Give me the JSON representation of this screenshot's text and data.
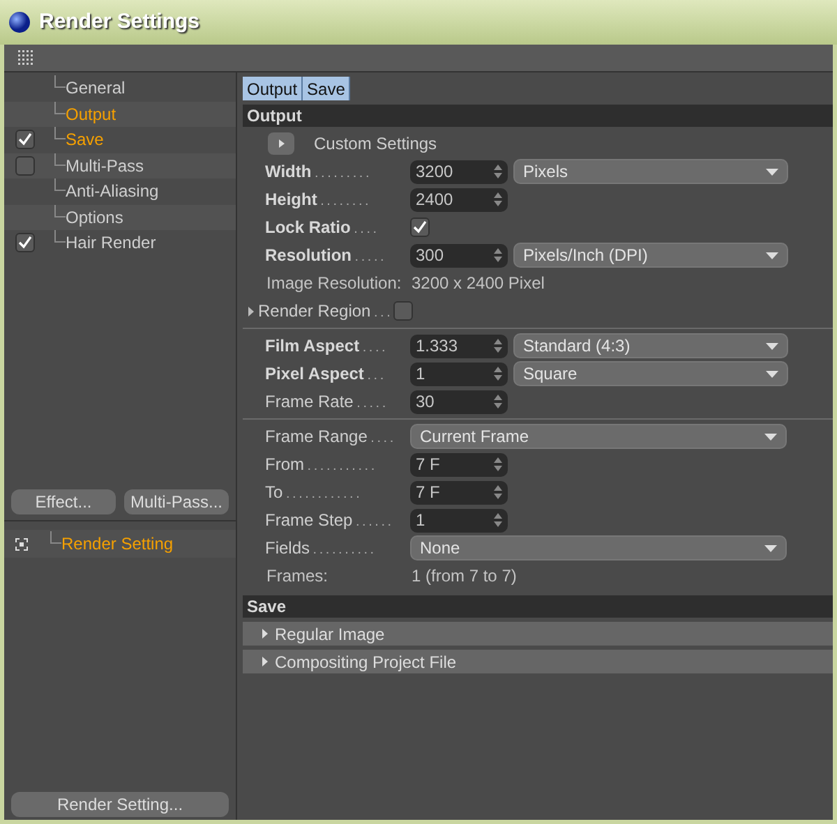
{
  "window": {
    "title": "Render Settings"
  },
  "tree": [
    {
      "label": "General",
      "kind": "plain",
      "highlighted": false
    },
    {
      "label": "Output",
      "kind": "plain",
      "highlighted": true
    },
    {
      "label": "Save",
      "kind": "check",
      "checked": true,
      "highlighted": true
    },
    {
      "label": "Multi-Pass",
      "kind": "check",
      "checked": false,
      "highlighted": false
    },
    {
      "label": "Anti-Aliasing",
      "kind": "plain",
      "highlighted": false
    },
    {
      "label": "Options",
      "kind": "plain",
      "highlighted": false
    },
    {
      "label": "Hair Render",
      "kind": "check",
      "checked": true,
      "highlighted": false
    }
  ],
  "left_buttons": [
    "Effect...",
    "Multi-Pass..."
  ],
  "presets": [
    {
      "label": "Render Setting",
      "highlighted": true
    }
  ],
  "bottom_button": "Render Setting...",
  "tabs": [
    {
      "label": "Output",
      "selected": true
    },
    {
      "label": "Save",
      "selected": true
    }
  ],
  "output": {
    "title": "Output",
    "groups": [
      [
        {
          "kind": "expander",
          "label": "Custom Settings"
        },
        {
          "kind": "number_select",
          "label": "Width",
          "leader": ". . . . . . . . .",
          "bold": true,
          "value": "3200",
          "option": "Pixels"
        },
        {
          "kind": "number",
          "label": "Height",
          "leader": ". . . . . . . .",
          "bold": true,
          "value": "2400"
        },
        {
          "kind": "check",
          "label": "Lock Ratio",
          "leader": ". . . .",
          "bold": true,
          "checked": true
        },
        {
          "kind": "number_select",
          "label": "Resolution",
          "leader": ". . . . .",
          "bold": true,
          "value": "300",
          "option": "Pixels/Inch (DPI)"
        },
        {
          "kind": "info",
          "label": "Image Resolution:",
          "value": "3200 x 2400 Pixel"
        },
        {
          "kind": "collapsed_check",
          "label": "Render Region",
          "leader": ". . .",
          "bold": false,
          "checked": false
        }
      ],
      [
        {
          "kind": "number_select",
          "label": "Film Aspect",
          "leader": ". . . .",
          "bold": true,
          "value": "1.333",
          "option": "Standard (4:3)"
        },
        {
          "kind": "number_select",
          "label": "Pixel Aspect",
          "leader": ". . .",
          "bold": true,
          "value": "1",
          "option": "Square"
        },
        {
          "kind": "number",
          "label": "Frame Rate",
          "leader": ". . . . .",
          "bold": false,
          "value": "30"
        }
      ],
      [
        {
          "kind": "select",
          "label": "Frame Range",
          "leader": ". . . .",
          "bold": false,
          "option": "Current Frame"
        },
        {
          "kind": "number",
          "label": "From",
          "leader": ". . . . . . . . . . .",
          "bold": false,
          "value": "7 F"
        },
        {
          "kind": "number",
          "label": "To",
          "leader": ". . . . . . . . . . . .",
          "bold": false,
          "value": "7 F"
        },
        {
          "kind": "number",
          "label": "Frame Step",
          "leader": ". . . . . .",
          "bold": false,
          "value": "1"
        },
        {
          "kind": "select",
          "label": "Fields",
          "leader": ". . . . . . . . . .",
          "bold": false,
          "option": "None"
        },
        {
          "kind": "info",
          "label": "Frames:",
          "value": "1 (from 7 to 7)"
        }
      ]
    ]
  },
  "save": {
    "title": "Save",
    "items": [
      "Regular Image",
      "Compositing Project File"
    ]
  }
}
